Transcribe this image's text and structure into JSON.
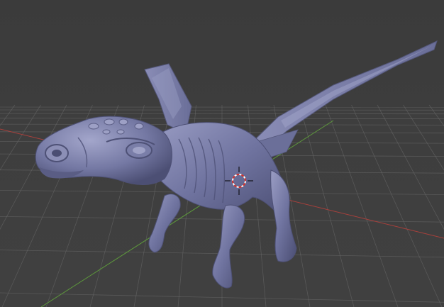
{
  "viewport": {
    "background_color": "#3d3d3d",
    "grid_color": "#6e6e6e",
    "x_axis_color": "#a8403c",
    "y_axis_color": "#5e9a3c",
    "mesh_color": "#767aa5",
    "view_mode": "perspective",
    "shading": "solid",
    "grid_visible": true
  },
  "scene": {
    "object": {
      "name_icon": "dragon-mesh-icon",
      "type": "sculpt-mesh"
    },
    "cursor": {
      "icon": "3d-cursor-icon"
    }
  }
}
